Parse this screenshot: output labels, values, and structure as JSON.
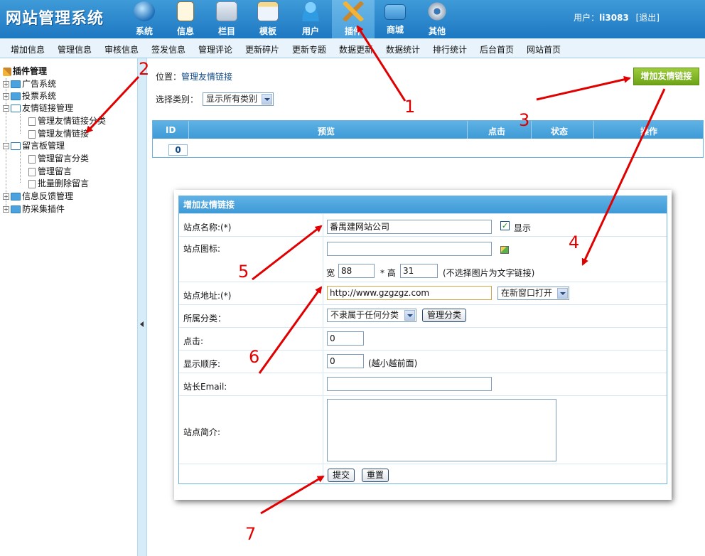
{
  "header": {
    "logo": "网站管理系统",
    "nav": [
      {
        "label": "系统",
        "icon": "globe-icon"
      },
      {
        "label": "信息",
        "icon": "notepad-icon"
      },
      {
        "label": "栏目",
        "icon": "folder-icon"
      },
      {
        "label": "模板",
        "icon": "window-icon"
      },
      {
        "label": "用户",
        "icon": "user-icon"
      },
      {
        "label": "插件",
        "icon": "tools-icon",
        "active": true
      },
      {
        "label": "商城",
        "icon": "card-icon"
      },
      {
        "label": "其他",
        "icon": "gear-icon"
      }
    ],
    "user_label": "用户：",
    "user_name": "li3083",
    "logout": "[退出]"
  },
  "subnav": [
    "增加信息",
    "管理信息",
    "审核信息",
    "签发信息",
    "管理评论",
    "更新碎片",
    "更新专题",
    "数据更新",
    "数据统计",
    "排行统计",
    "后台首页",
    "网站首页"
  ],
  "tree": {
    "root": "插件管理",
    "items": [
      "广告系统",
      "投票系统",
      "友情链接管理",
      "管理友情链接分类",
      "管理友情链接",
      "留言板管理",
      "管理留言分类",
      "管理留言",
      "批量删除留言",
      "信息反馈管理",
      "防采集插件"
    ]
  },
  "main": {
    "breadcrumb_prefix": "位置：",
    "breadcrumb_link": "管理友情链接",
    "add_button": "增加友情链接",
    "filter_label": "选择类别：",
    "filter_value": "显示所有类别",
    "columns": [
      "ID",
      "预览",
      "点击",
      "状态",
      "操作"
    ],
    "count_cell": "0"
  },
  "form": {
    "title": "增加友情链接",
    "labels": {
      "name": "站点名称:(*)",
      "logo": "站点图标:",
      "url": "站点地址:(*)",
      "category": "所属分类：",
      "clicks": "点击:",
      "order": "显示顺序:",
      "email": "站长Email:",
      "intro": "站点简介:"
    },
    "name_value": "番禺建网站公司",
    "show_label": "显示",
    "show_checked": "✓",
    "width_label": "宽",
    "width_value": "88",
    "height_label": "* 高",
    "height_value": "31",
    "size_note": "(不选择图片为文字链接)",
    "url_value": "http://www.gzgzgz.com",
    "target_value": "在新窗口打开",
    "category_value": "不隶属于任何分类",
    "manage_category": "管理分类",
    "clicks_value": "0",
    "order_value": "0",
    "order_note": "(越小越前面)",
    "submit": "提交",
    "reset": "重置"
  },
  "annotations": [
    "1",
    "2",
    "3",
    "4",
    "5",
    "6",
    "7"
  ],
  "colors": {
    "header": "#1d78c2",
    "accent": "#3e9ad6",
    "add_button": "#7cb526",
    "annotation": "#e10000"
  }
}
